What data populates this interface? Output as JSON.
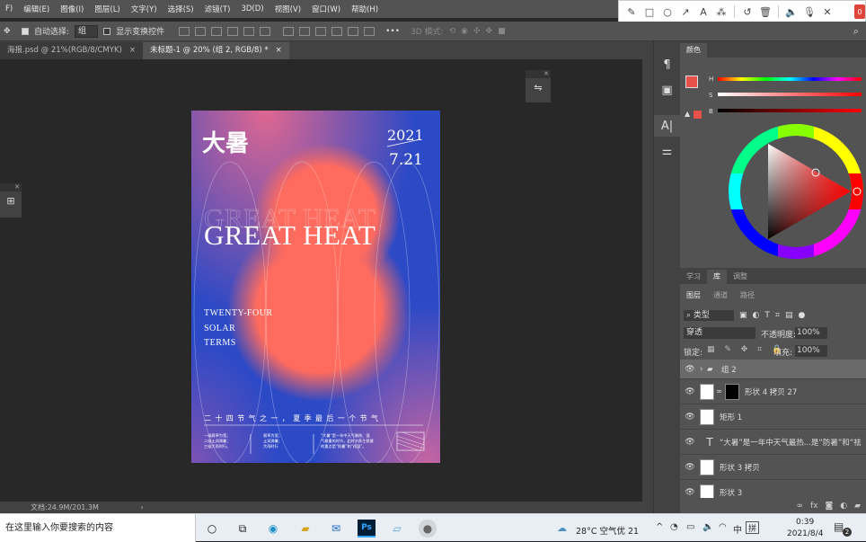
{
  "menu": [
    "F)",
    "编辑(E)",
    "图像(I)",
    "图层(L)",
    "文字(Y)",
    "选择(S)",
    "滤镜(T)",
    "3D(D)",
    "视图(V)",
    "窗口(W)",
    "帮助(H)"
  ],
  "options_bar": {
    "auto_select_label": "自动选择:",
    "auto_select_value": "组",
    "show_transform_label": "显示变换控件",
    "mode_3d_label": "3D 模式:"
  },
  "tabs": [
    {
      "label": "海报.psd @ 21%(RGB/8/CMYK)",
      "close": "×"
    },
    {
      "label": "未标题-1 @ 20% (组 2, RGB/8) *",
      "close": "×"
    }
  ],
  "poster": {
    "title_cn": "大暑",
    "year": "2021",
    "date": "7.21",
    "headline": "GREAT HEAT",
    "subtitle_lines": [
      "TWENTY-FOUR",
      "SOLAR",
      "TERMS"
    ],
    "tagline": "二十四节气之一，夏季最后一个节气",
    "col1": [
      "一候腐草为萤；",
      "二候土润溽暑；",
      "三候大雨时行。"
    ],
    "col2": [
      "腐草为萤；",
      "土润溽暑；",
      "大雨时行"
    ],
    "col3": [
      "“大暑”是一年中天气最热、湿",
      "气最重的时节，此时节养生保健",
      "的重点是“防暑”和“祛湿”。"
    ]
  },
  "status": {
    "doc_size": "文档:24.9M/201.3M",
    "arrow": "›"
  },
  "color_panel": {
    "tab": "颜色",
    "h_label": "H",
    "s_label": "S",
    "b_label": "B"
  },
  "mid_tabs": [
    "学习",
    "库",
    "调整"
  ],
  "layer_tabs": [
    "图层",
    "通道",
    "路径"
  ],
  "layers_panel": {
    "kind_label": "类型",
    "blend_mode": "穿透",
    "opacity_label": "不透明度:",
    "opacity_value": "100%",
    "lock_label": "锁定:",
    "fill_label": "填充:",
    "fill_value": "100%"
  },
  "layers": [
    {
      "name": "组 2",
      "type": "group"
    },
    {
      "name": "形状 4 拷贝 27",
      "type": "shape-mask"
    },
    {
      "name": "矩形 1",
      "type": "shape"
    },
    {
      "name": "“大暑”是一年中天气最热...是“防暑”和“祛",
      "type": "text"
    },
    {
      "name": "形状 3 拷贝",
      "type": "shape"
    },
    {
      "name": "形状 3",
      "type": "shape"
    }
  ],
  "taskbar": {
    "search_placeholder": "在这里输入你要搜索的内容",
    "weather": "28°C 空气优 21",
    "ime": "拼",
    "time": "0:39",
    "date": "2021/8/4",
    "notifications": "2"
  },
  "colors": {
    "poster_blue": "#2c49c6",
    "poster_coral": "#ff6b5e",
    "foreground": "#e8504a"
  }
}
